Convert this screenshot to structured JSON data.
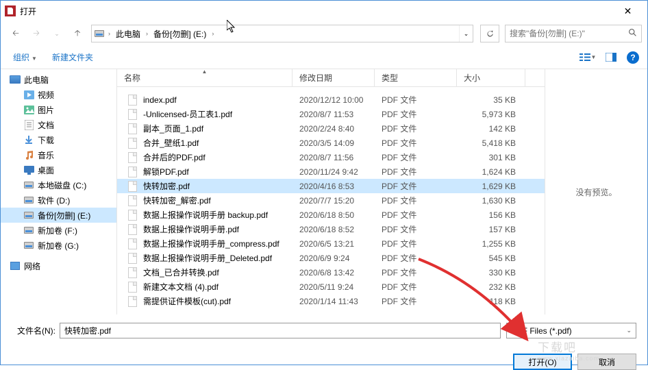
{
  "window": {
    "title": "打开"
  },
  "nav": {
    "breadcrumb": [
      "此电脑",
      "备份[勿删] (E:)"
    ],
    "search_placeholder": "搜索\"备份[勿删] (E:)\""
  },
  "toolbar": {
    "organize": "组织",
    "newfolder": "新建文件夹"
  },
  "sidebar": {
    "items": [
      {
        "label": "此电脑",
        "icon": "monitor",
        "lvl": 1
      },
      {
        "label": "视频",
        "icon": "video",
        "lvl": 2
      },
      {
        "label": "图片",
        "icon": "picture",
        "lvl": 2
      },
      {
        "label": "文档",
        "icon": "document",
        "lvl": 2
      },
      {
        "label": "下载",
        "icon": "download",
        "lvl": 2
      },
      {
        "label": "音乐",
        "icon": "music",
        "lvl": 2
      },
      {
        "label": "桌面",
        "icon": "desktop",
        "lvl": 2
      },
      {
        "label": "本地磁盘 (C:)",
        "icon": "disk",
        "lvl": 2
      },
      {
        "label": "软件 (D:)",
        "icon": "disk",
        "lvl": 2
      },
      {
        "label": "备份[勿删] (E:)",
        "icon": "disk",
        "lvl": 2,
        "selected": true
      },
      {
        "label": "新加卷 (F:)",
        "icon": "disk",
        "lvl": 2
      },
      {
        "label": "新加卷 (G:)",
        "icon": "disk",
        "lvl": 2
      },
      {
        "label": "",
        "icon": "",
        "lvl": 2,
        "spacer": true
      },
      {
        "label": "网络",
        "icon": "network",
        "lvl": 1
      }
    ]
  },
  "columns": {
    "name": "名称",
    "date": "修改日期",
    "type": "类型",
    "size": "大小"
  },
  "files": [
    {
      "name": "index.pdf",
      "date": "2020/12/12 10:00",
      "type": "PDF 文件",
      "size": "35 KB"
    },
    {
      "name": "-Unlicensed-员工表1.pdf",
      "date": "2020/8/7 11:53",
      "type": "PDF 文件",
      "size": "5,973 KB"
    },
    {
      "name": "副本_页面_1.pdf",
      "date": "2020/2/24 8:40",
      "type": "PDF 文件",
      "size": "142 KB"
    },
    {
      "name": "合并_壁纸1.pdf",
      "date": "2020/3/5 14:09",
      "type": "PDF 文件",
      "size": "5,418 KB"
    },
    {
      "name": "合并后的PDF.pdf",
      "date": "2020/8/7 11:56",
      "type": "PDF 文件",
      "size": "301 KB"
    },
    {
      "name": "解锁PDF.pdf",
      "date": "2020/11/24 9:42",
      "type": "PDF 文件",
      "size": "1,624 KB"
    },
    {
      "name": "快转加密.pdf",
      "date": "2020/4/16 8:53",
      "type": "PDF 文件",
      "size": "1,629 KB",
      "selected": true
    },
    {
      "name": "快转加密_解密.pdf",
      "date": "2020/7/7 15:20",
      "type": "PDF 文件",
      "size": "1,630 KB"
    },
    {
      "name": "数据上报操作说明手册 backup.pdf",
      "date": "2020/6/18 8:50",
      "type": "PDF 文件",
      "size": "156 KB"
    },
    {
      "name": "数据上报操作说明手册.pdf",
      "date": "2020/6/18 8:52",
      "type": "PDF 文件",
      "size": "157 KB"
    },
    {
      "name": "数据上报操作说明手册_compress.pdf",
      "date": "2020/6/5 13:21",
      "type": "PDF 文件",
      "size": "1,255 KB"
    },
    {
      "name": "数据上报操作说明手册_Deleted.pdf",
      "date": "2020/6/9 9:24",
      "type": "PDF 文件",
      "size": "545 KB"
    },
    {
      "name": "文档_已合并转换.pdf",
      "date": "2020/6/8 13:42",
      "type": "PDF 文件",
      "size": "330 KB"
    },
    {
      "name": "新建文本文档 (4).pdf",
      "date": "2020/5/11 9:24",
      "type": "PDF 文件",
      "size": "232 KB"
    },
    {
      "name": "需提供证件模板(cut).pdf",
      "date": "2020/1/14 11:43",
      "type": "PDF 文件",
      "size": "118 KB"
    }
  ],
  "preview": {
    "empty": "没有预览。"
  },
  "bottom": {
    "filename_label": "文件名(N):",
    "filename_value": "快转加密.pdf",
    "filetype": "PDF Files (*.pdf)",
    "open": "打开(O)",
    "cancel": "取消"
  },
  "watermark": {
    "main": "下载吧",
    "sub": "www.xiazaiba.com"
  }
}
